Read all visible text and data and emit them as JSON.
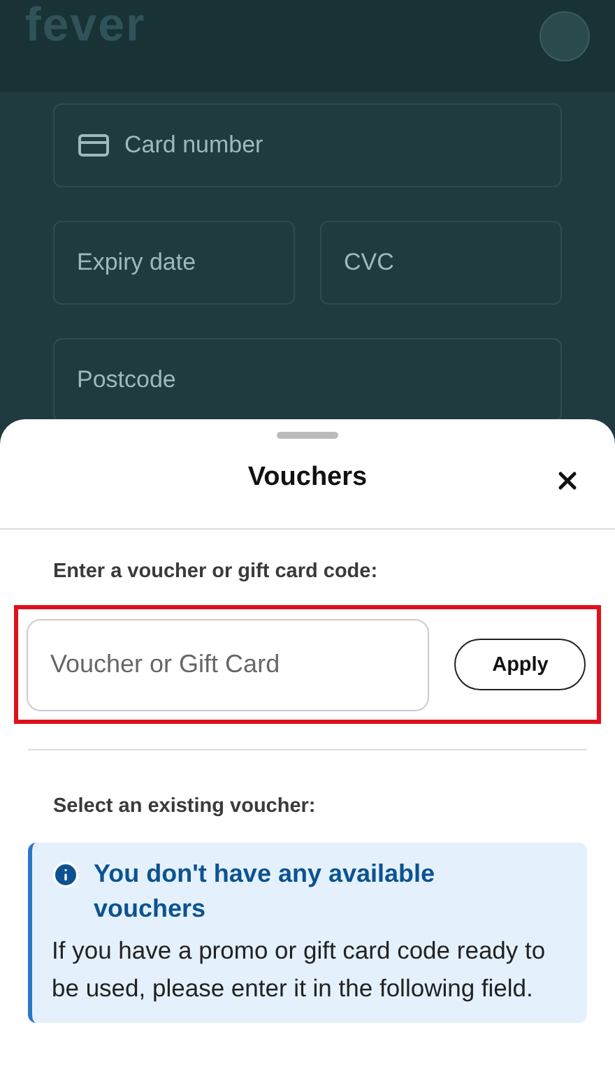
{
  "header": {
    "logo": "fever"
  },
  "payment_form": {
    "card_number": {
      "placeholder": "Card number"
    },
    "expiry": {
      "placeholder": "Expiry date"
    },
    "cvc": {
      "placeholder": "CVC"
    },
    "postcode": {
      "placeholder": "Postcode"
    }
  },
  "sheet": {
    "title": "Vouchers",
    "code_label": "Enter a voucher or gift card code:",
    "code_field": {
      "placeholder": "Voucher or Gift Card"
    },
    "apply_button": "Apply",
    "existing_label": "Select an existing voucher:",
    "notice": {
      "title": "You don't have any available vouchers",
      "body": "If you have a promo or gift card code ready to be used, please enter it in the following field."
    }
  }
}
